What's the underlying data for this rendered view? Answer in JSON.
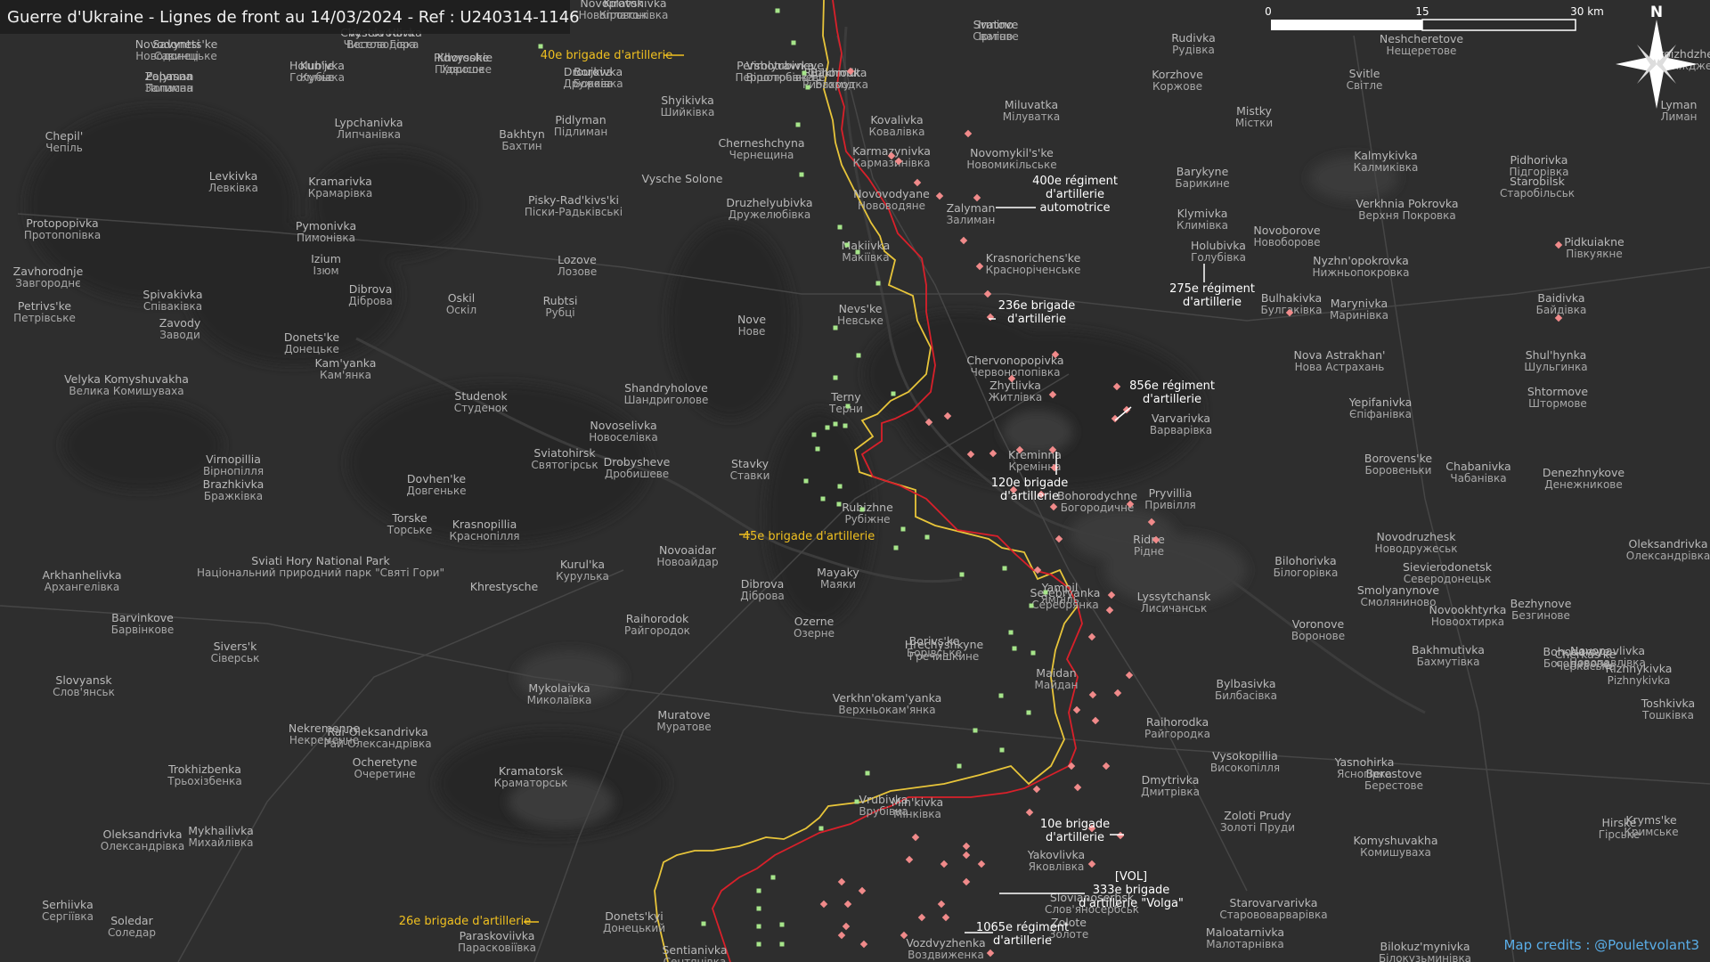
{
  "title": "Guerre d'Ukraine - Lignes de front au 14/03/2024 - Ref : U240314-1146",
  "credits": "Map credits : @Pouletvolant3",
  "north_label": "N",
  "scale": {
    "labels": [
      "0",
      "15",
      "30 km"
    ]
  },
  "colors": {
    "ukraine_line": "#e8c53a",
    "russia_line": "#d9202a",
    "ua_marker": "#a6e58a",
    "ru_marker": "#f08a8a",
    "ua_label": "#f0c020",
    "white_label": "#ffffff"
  },
  "places": [
    [
      "Novoplatonivka",
      "Новоплатонівка"
    ],
    [
      "Savyntsi",
      "Савинці"
    ],
    [
      "Chystovodivka",
      "Чистоводівка"
    ],
    [
      "Zalyman",
      "Залиман"
    ],
    [
      "Kun'je",
      "Кунье"
    ],
    [
      "Pidvysokie",
      "Підвисоке"
    ],
    [
      "Borova",
      "Борова"
    ],
    [
      "Pershotravneve",
      "Першотравневе"
    ],
    [
      "Ribhorodka",
      "Рибгородка"
    ],
    [
      "Svatove",
      "Сватове"
    ],
    [
      "Rudivka",
      "Рудівка"
    ],
    [
      "Korzhove",
      "Коржове"
    ],
    [
      "Neshcheretove",
      "Нещеретове"
    ],
    [
      "Svitle",
      "Світле"
    ],
    [
      "Proizhdzhe",
      "Проїжджe"
    ],
    [
      "Lyman",
      "Лиман"
    ],
    [
      "Chepil'",
      "Чепіль"
    ],
    [
      "Lypchanivka",
      "Липчанівка"
    ],
    [
      "Pidlyman",
      "Підлиман"
    ],
    [
      "Bakhtyn",
      "Бахтин"
    ],
    [
      "Shyikivka",
      "Шийківка"
    ],
    [
      "Kovalivka",
      "Ковалівка"
    ],
    [
      "Miluvatka",
      "Мілуватка"
    ],
    [
      "Mistky",
      "Містки"
    ],
    [
      "Karmazynivka",
      "Кармазинівка"
    ],
    [
      "Novomykil's'ke",
      "Новомикільське"
    ],
    [
      "Kalmykivka",
      "Калмиківка"
    ],
    [
      "Pidhorivka",
      "Підгорівка"
    ],
    [
      "Levkivka",
      "Левківка"
    ],
    [
      "Kramarivka",
      "Крамарівка"
    ],
    [
      "Cherneshchyna",
      "Чернещина"
    ],
    [
      "Starobilsk",
      "Старобільськ"
    ],
    [
      "Vysche Solone",
      ""
    ],
    [
      "Pisky-Rad'kivs'ki",
      "Піски-Радьківські"
    ],
    [
      "Druzhelyubivka",
      "Дружелюбівка"
    ],
    [
      "Novovodyane",
      "Нововодяне"
    ],
    [
      "Barykyne",
      "Барикине"
    ],
    [
      "Klymivka",
      "Климівка"
    ],
    [
      "Verkhnia Pokrovka",
      "Верхня Покровка"
    ],
    [
      "Protopopivka",
      "Протопопівка"
    ],
    [
      "Pymonivka",
      "Пимонівка"
    ],
    [
      "Zalyman",
      "Залиман"
    ],
    [
      "Holubivka",
      "Голубівка"
    ],
    [
      "Novoborove",
      "Новоборове"
    ],
    [
      "Zavhorodnje",
      "Завгороднє"
    ],
    [
      "Izium",
      "Ізюм"
    ],
    [
      "Lozove",
      "Лозове"
    ],
    [
      "Makiivka",
      "Макіївка"
    ],
    [
      "Krasnorichens'ke",
      "Красноріченське"
    ],
    [
      "Nyzhn'opokrovka",
      "Нижньопокровка"
    ],
    [
      "Pidkuiakne",
      "Півкуякне"
    ],
    [
      "Dibrova",
      "Діброва"
    ],
    [
      "Spivakivka",
      "Співаківка"
    ],
    [
      "Petrivs'ke",
      "Петрівське"
    ],
    [
      "Oskil",
      "Оскіл"
    ],
    [
      "Rubtsi",
      "Рубці"
    ],
    [
      "Nevs'ke",
      "Невське"
    ],
    [
      "Bulhakivka",
      "Булгаківка"
    ],
    [
      "Marynivka",
      "Маринівка"
    ],
    [
      "Baidivka",
      "Байдівка"
    ],
    [
      "Zavody",
      "Заводи"
    ],
    [
      "Donets'ke",
      "Донецьке"
    ],
    [
      "Nove",
      "Нове"
    ],
    [
      "Kam'yanka",
      "Кам'янка"
    ],
    [
      "Velyka Komyshuvakha",
      "Велика Комишуваха"
    ],
    [
      "Chervonopopivka",
      "Червонопопівка"
    ],
    [
      "Nova Astrakhan'",
      "Нова Астрахань"
    ],
    [
      "Shul'hynka",
      "Шульгинка"
    ],
    [
      "Studenok",
      "Студенок"
    ],
    [
      "Shandryholove",
      "Шандриголове"
    ],
    [
      "Zhytlivka",
      "Житлівка"
    ],
    [
      "Varvarivka",
      "Варварівка"
    ],
    [
      "Yepifanivka",
      "Єпіфанівка"
    ],
    [
      "Shtormove",
      "Штормове"
    ],
    [
      "Novoselivka",
      "Новоселівка"
    ],
    [
      "Terny",
      "Терни"
    ],
    [
      "Kreminna",
      "Кремінна"
    ],
    [
      "Sviatohirsk",
      "Святогірськ"
    ],
    [
      "Drobysheve",
      "Дробишеве"
    ],
    [
      "Stavky",
      "Ставки"
    ],
    [
      "Borovens'ke",
      "Боровеньки"
    ],
    [
      "Chabanivka",
      "Чабанівка"
    ],
    [
      "Denezhnykove",
      "Денежникове"
    ],
    [
      "Virnopillia",
      "Вірнопілля"
    ],
    [
      "Brazhkivka",
      "Бражківка"
    ],
    [
      "Dovhen'ke",
      "Довгеньке"
    ],
    [
      "Bohorodychne",
      "Богородичне"
    ],
    [
      "Pryvillia",
      "Привілля"
    ],
    [
      "Rubizhne",
      "Рубіжне"
    ],
    [
      "Torske",
      "Торське"
    ],
    [
      "Krasnopillia",
      "Краснопілля"
    ],
    [
      "Ridne",
      "Рідне"
    ],
    [
      "Novodruzhesk",
      "Новодружеськ"
    ],
    [
      "Oleksandrivka",
      "Олександрівка"
    ],
    [
      "Novoaidar",
      "Новоайдар"
    ],
    [
      "Sviati Hory National Park",
      "Національний природний парк \"Святі Гори\""
    ],
    [
      "Kurul'ka",
      "Курулька"
    ],
    [
      "Mayaky",
      "Маяки"
    ],
    [
      "Yampil",
      "Ямпіль"
    ],
    [
      "Bilohorivka",
      "Білогорівка"
    ],
    [
      "Sievierodonetsk",
      "Северодонецьк"
    ],
    [
      "Smolyanynove",
      "Смоляниново"
    ],
    [
      "Arkhanhelivka",
      "Архангелівка"
    ],
    [
      "Khrestysche",
      ""
    ],
    [
      "Dibrova",
      "Діброва"
    ],
    [
      "Serebryanka",
      "Серебрянка"
    ],
    [
      "Lyssytchansk",
      "Лисичанськ"
    ],
    [
      "Novookhtyrka",
      "Новоохтирка"
    ],
    [
      "Bezhynove",
      "Безгинове"
    ],
    [
      "Barvinkove",
      "Барвінкове"
    ],
    [
      "Raihorodok",
      "Райгородок"
    ],
    [
      "Ozerne",
      "Озерне"
    ],
    [
      "Voronove",
      "Воронове"
    ],
    [
      "Novopavlivka",
      "Новопавлівка"
    ],
    [
      "Sivers'k",
      "Сіверськ"
    ],
    [
      "Borivs'ke",
      "Борівське"
    ],
    [
      "Hrechyshkyne",
      "Гречишкине"
    ],
    [
      "Bakhmutivka",
      "Бахмутівка"
    ],
    [
      "Bohodarove",
      "Богодарове"
    ],
    [
      "Slovyansk",
      "Слов'янськ"
    ],
    [
      "Mykolaivka",
      "Миколаївка"
    ],
    [
      "Verkhn'okam'yanka",
      "Верхньокам'янка"
    ],
    [
      "Maidan",
      "Майдан"
    ],
    [
      "Bylbasivka",
      "Билбасівка"
    ],
    [
      "Cherkas'ke",
      "Черкаське"
    ],
    [
      "Rizhnykivka",
      "Рizhnykivka"
    ],
    [
      "Nekremenne",
      "Некременне"
    ],
    [
      "Rai-Oleksandrivka",
      "Рай-Олександрівка"
    ],
    [
      "Muratove",
      "Муратове"
    ],
    [
      "Raihorodka",
      "Райгородка"
    ],
    [
      "Vysokopillia",
      "Високопілля"
    ],
    [
      "Yasnohirka",
      "Ясногірка"
    ],
    [
      "Toshkivka",
      "Тошківка"
    ],
    [
      "Trokhizbenka",
      "Трьохізбенка"
    ],
    [
      "Ocheretyne",
      "Очеретине"
    ],
    [
      "Dmytrivka",
      "Дмитрівка"
    ],
    [
      "Berestove",
      "Берестове"
    ],
    [
      "Kryms'ke",
      "Кримське"
    ],
    [
      "Mykhailivka",
      "Михайлівка"
    ],
    [
      "Kramatorsk",
      "Краматорськ"
    ],
    [
      "Vrubivka",
      "Врубівка"
    ],
    [
      "Zoloti Prudy",
      "Золоті Пруди"
    ],
    [
      "Hirske",
      "Гірське"
    ],
    [
      "Oleksandrivka",
      "Олександрівка"
    ],
    [
      "Min'kivka",
      "Мінківка"
    ],
    [
      "Yakovlivka",
      "Яковлівка"
    ],
    [
      "Komyshuvakha",
      "Комишуваха"
    ],
    [
      "Donets'kyi",
      "Донецький"
    ],
    [
      "Slovianoserbsk",
      "Слов'яносербськ"
    ],
    [
      "Starovarvarivka",
      "Старововарварівка"
    ],
    [
      "Serhiivka",
      "Сергіївка"
    ],
    [
      "Soledar",
      "Соледар"
    ],
    [
      "Zolote",
      "Золоте"
    ],
    [
      "Maloatarnivka",
      "Малотарнівка"
    ],
    [
      "Paraskoviivka",
      "Парасковіївка"
    ],
    [
      "Vozdvyzhenka",
      "Воздвиженка"
    ],
    [
      "Sentianivka",
      "Сентянівка"
    ],
    [
      "Bilokuz'mynivka",
      "Білокузьминівка"
    ],
    [
      "Kirovsk",
      "Кіровськ"
    ],
    [
      "Novodonets'ke",
      "Новодонецьке"
    ],
    [
      "Vesela Hora",
      "Весела Гора"
    ],
    [
      "Popasna",
      "Попасна"
    ],
    [
      "Holubivka",
      "Голубівка"
    ],
    [
      "Khoroshe",
      "Хороше"
    ],
    [
      "Droujkivka",
      "Дружківка"
    ],
    [
      "Virolyubivka",
      "Віролюбівка"
    ],
    [
      "Bakhmut",
      "Бахмут"
    ],
    [
      "Irmino",
      "Ірміно"
    ]
  ],
  "units": [
    {
      "text": "40e brigade d'artillerie",
      "side": "ua"
    },
    {
      "text": "45e brigade d'artillerie",
      "side": "ua"
    },
    {
      "text": "26e brigade d'artillerie",
      "side": "ua"
    },
    {
      "text": "400e régiment\nd'artillerie\nautomotrice",
      "side": "ru"
    },
    {
      "text": "275e régiment\nd'artillerie",
      "side": "ru"
    },
    {
      "text": "236e brigade\nd'artillerie",
      "side": "ru"
    },
    {
      "text": "856e régiment\nd'artillerie",
      "side": "ru"
    },
    {
      "text": "120e brigade\nd'artillerie",
      "side": "ru"
    },
    {
      "text": "10e brigade\nd'artillerie",
      "side": "ru"
    },
    {
      "text": "[VOL]\n333e brigade\nd'artillerie \"Volga\"",
      "side": "ru"
    },
    {
      "text": "1065e régiment\nd'artillerie",
      "side": "ru"
    }
  ]
}
